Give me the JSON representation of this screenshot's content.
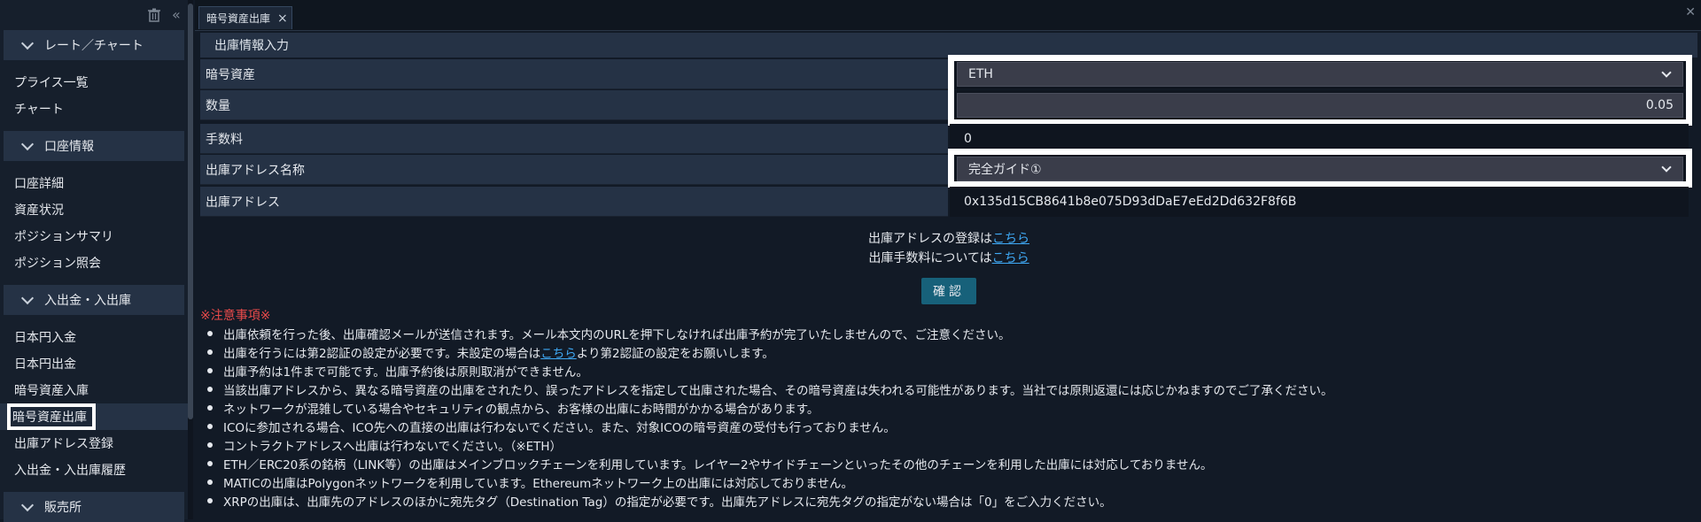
{
  "sidebar": {
    "sections": [
      {
        "label": "レート／チャート",
        "items": [
          "プライス一覧",
          "チャート"
        ]
      },
      {
        "label": "口座情報",
        "items": [
          "口座詳細",
          "資産状況",
          "ポジションサマリ",
          "ポジション照会"
        ]
      },
      {
        "label": "入出金・入出庫",
        "items": [
          "日本円入金",
          "日本円出金",
          "暗号資産入庫",
          "暗号資産出庫",
          "出庫アドレス登録",
          "入出金・入出庫履歴"
        ]
      },
      {
        "label": "販売所",
        "items": []
      }
    ],
    "active_item": "暗号資産出庫"
  },
  "tab": {
    "label": "暗号資産出庫",
    "close": "×"
  },
  "form": {
    "header": "出庫情報入力",
    "rows": {
      "asset_label": "暗号資産",
      "asset_value": "ETH",
      "qty_label": "数量",
      "qty_value": "0.05",
      "fee_label": "手数料",
      "fee_value": "0",
      "addr_name_label": "出庫アドレス名称",
      "addr_name_value": "完全ガイド①",
      "addr_label": "出庫アドレス",
      "addr_value": "0x135d15CB8641b8e075D93dDaE7eEd2Dd632F8f6B"
    }
  },
  "links": {
    "register_prefix": "出庫アドレスの登録は",
    "register_link": "こちら",
    "fee_prefix": "出庫手数料については",
    "fee_link": "こちら"
  },
  "confirm_label": "確認",
  "notice": {
    "title": "※注意事項※",
    "items": [
      {
        "text": "出庫依頼を行った後、出庫確認メールが送信されます。メール本文内のURLを押下しなければ出庫予約が完了いたしませんので、ご注意ください。"
      },
      {
        "pre": "出庫を行うには第2認証の設定が必要です。未設定の場合は",
        "link": "こちら",
        "post": "より第2認証の設定をお願いします。"
      },
      {
        "text": "出庫予約は1件まで可能です。出庫予約後は原則取消ができません。"
      },
      {
        "text": "当該出庫アドレスから、異なる暗号資産の出庫をされたり、誤ったアドレスを指定して出庫された場合、その暗号資産は失われる可能性があります。当社では原則返還には応じかねますのでご了承ください。"
      },
      {
        "text": "ネットワークが混雑している場合やセキュリティの観点から、お客様の出庫にお時間がかかる場合があります。"
      },
      {
        "text": "ICOに参加される場合、ICO先への直接の出庫は行わないでください。また、対象ICOの暗号資産の受付も行っておりません。"
      },
      {
        "text": "コントラクトアドレスへ出庫は行わないでください。（※ETH）"
      },
      {
        "text": "ETH／ERC20系の銘柄（LINK等）の出庫はメインブロックチェーンを利用しています。レイヤー2やサイドチェーンといったその他のチェーンを利用した出庫には対応しておりません。"
      },
      {
        "text": "MATICの出庫はPolygonネットワークを利用しています。Ethereumネットワーク上の出庫には対応しておりません。"
      },
      {
        "text": "XRPの出庫は、出庫先のアドレスのほかに宛先タグ（Destination Tag）の指定が必要です。出庫先アドレスに宛先タグの指定がない場合は「0」をご入力ください。"
      }
    ]
  },
  "colors": {
    "accent": "#17617a",
    "link": "#3fa9f5",
    "warning": "#e84a4a",
    "panel": "#253245"
  }
}
